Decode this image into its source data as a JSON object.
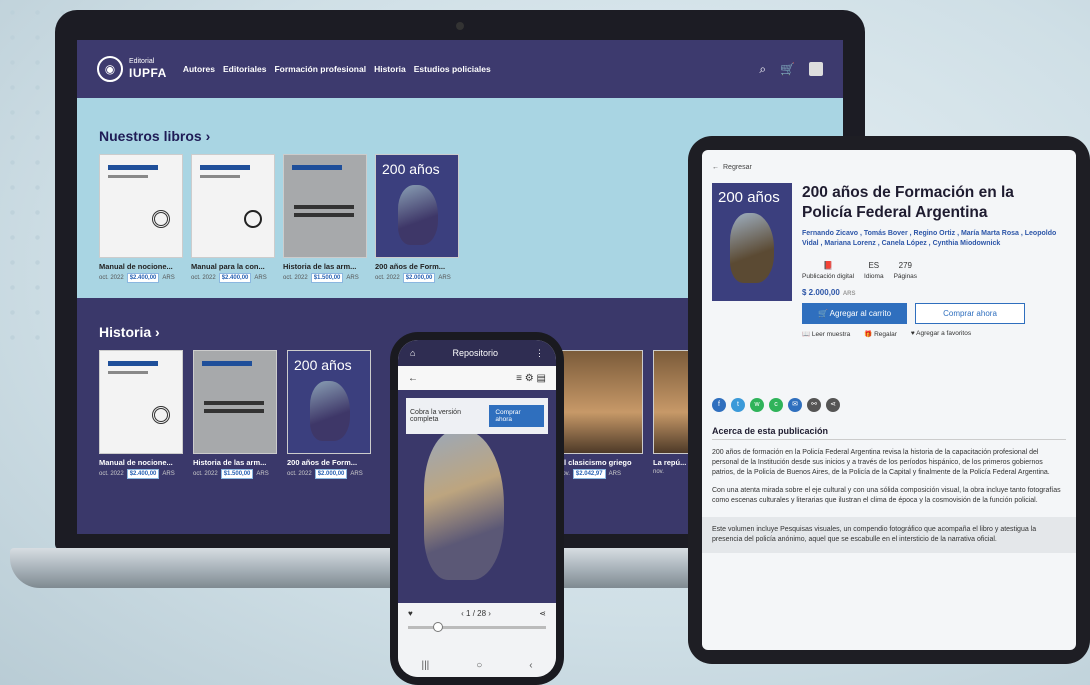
{
  "laptop": {
    "logo_small": "Editorial",
    "logo_big": "IUPFA",
    "nav": [
      "Autores",
      "Editoriales",
      "Formación profesional",
      "Historia",
      "Estudios policiales"
    ],
    "section1": {
      "title": "Nuestros libros",
      "books": [
        {
          "title": "Manual de nocione...",
          "date": "oct. 2022",
          "price": "$2.400,00",
          "currency": "ARS"
        },
        {
          "title": "Manual para la con...",
          "date": "oct. 2022",
          "price": "$2.400,00",
          "currency": "ARS"
        },
        {
          "title": "Historia de las arm...",
          "date": "oct. 2022",
          "price": "$1.500,00",
          "currency": "ARS"
        },
        {
          "title": "200 años de Form...",
          "date": "oct. 2022",
          "price": "$2.000,00",
          "currency": "ARS"
        }
      ]
    },
    "section2": {
      "title": "Historia",
      "books": [
        {
          "title": "Manual de nocione...",
          "date": "oct. 2022",
          "price": "$2.400,00",
          "currency": "ARS"
        },
        {
          "title": "Historia de las arm...",
          "date": "oct. 2022",
          "price": "$1.500,00",
          "currency": "ARS"
        },
        {
          "title": "200 años de Form...",
          "date": "oct. 2022",
          "price": "$2.000,00",
          "currency": "ARS"
        },
        {
          "title": "El clasicismo griego",
          "date": "nov.",
          "price": "$2.042,97",
          "currency": "ARS"
        },
        {
          "title": "La repú...",
          "date": "nov.",
          "price": "",
          "currency": ""
        }
      ]
    }
  },
  "tablet": {
    "back_label": "Regresar",
    "cover_text": "200 años",
    "title": "200 años de Formación en la Policía Federal Argentina",
    "authors": "Fernando Zicavo , Tomás Bover , Regino Ortiz , María Marta Rosa , Leopoldo Vidal , Mariana Lorenz , Canela López , Cynthia Miodownick",
    "stats": [
      {
        "value": "📕",
        "label": "Publicación digital"
      },
      {
        "value": "ES",
        "label": "Idioma"
      },
      {
        "value": "279",
        "label": "Páginas"
      }
    ],
    "price": "$ 2.000,00",
    "currency": "ARS",
    "add_to_cart": "🛒 Agregar al carrito",
    "buy_now": "Comprar ahora",
    "actions": [
      "📖 Leer muestra",
      "🎁 Regalar",
      "♥ Agregar a favoritos"
    ],
    "about_title": "Acerca de esta publicación",
    "about_p1": "200 años de formación en la Policía Federal Argentina revisa la historia de la capacitación profesional del personal de la Institución desde sus inicios y a través de los períodos hispánico, de los primeros gobiernos patrios, de la Policía de Buenos Aires, de la Policía de la Capital y finalmente de la Policía Federal Argentina.",
    "about_p2": "Con una atenta mirada sobre el eje cultural y con una sólida composición visual, la obra incluye tanto fotografías como escenas culturales y literarias que ilustran el clima de época y la cosmovisión de la función policial.",
    "about_note": "Este volumen incluye Pesquisas visuales, un compendio fotográfico que acompaña el libro y atestigua la presencia del policía anónimo, aquel que se escabulle en el intersticio de la narrativa oficial.",
    "share_colors": [
      "#2f6fbe",
      "#3b9ad9",
      "#2fb35a",
      "#2fb35a",
      "#2f6fbe",
      "#555555",
      "#555555"
    ]
  },
  "phone": {
    "status": "Repositorio",
    "banner_text": "Cobra la versión completa",
    "banner_btn": "Comprar ahora",
    "pager": "1 / 28",
    "prev": "‹",
    "next": "›"
  }
}
